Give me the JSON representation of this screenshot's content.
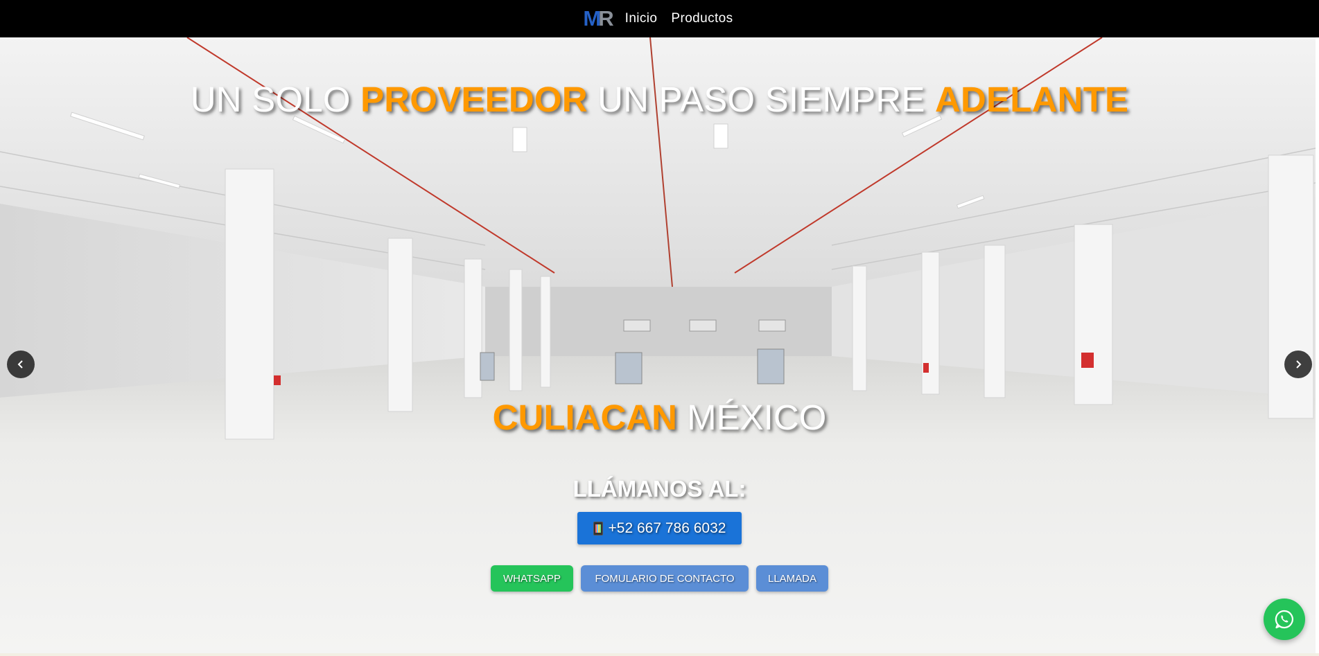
{
  "nav": {
    "logo_text": "MR",
    "links": [
      {
        "label": "Inicio"
      },
      {
        "label": "Productos"
      }
    ]
  },
  "hero": {
    "headline": {
      "part1": "UN SOLO ",
      "accent1": "PROVEEDOR",
      "part2": " UN PASO SIEMPRE ",
      "accent2": "ADELANTE"
    },
    "location": {
      "accent": "CULIACAN",
      "rest": " MÉXICO"
    },
    "call_heading": "LLÁMANOS AL:",
    "phone": "+52 667 786 6032",
    "buttons": {
      "whatsapp": "WHATSAPP",
      "form": "FOMULARIO DE CONTACTO",
      "call": "LLAMADA"
    }
  },
  "carousel": {
    "prev_icon": "chevron-left-icon",
    "next_icon": "chevron-right-icon"
  },
  "floating": {
    "icon": "whatsapp-icon"
  },
  "colors": {
    "nav_bg": "#000000",
    "accent_orange": "#ff9900",
    "logo_blue": "#2561c7",
    "phone_button": "#1a73d8",
    "whatsapp_green": "#25c45a",
    "secondary_button": "#5b8ed6"
  }
}
